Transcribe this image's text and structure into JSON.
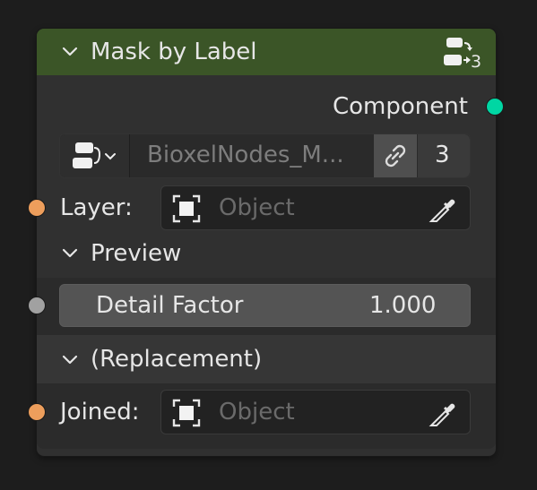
{
  "node": {
    "title": "Mask by Label",
    "header_badge_count": "3",
    "output_socket_label": "Component",
    "datablock": {
      "name": "BioxelNodes_M...",
      "user_count": "3"
    },
    "layer": {
      "label": "Layer:",
      "placeholder": "Object"
    },
    "panels": {
      "preview": {
        "title": "Preview",
        "detail_factor_label": "Detail Factor",
        "detail_factor_value": "1.000"
      },
      "replacement": {
        "title": "(Replacement)",
        "joined_label": "Joined:",
        "joined_placeholder": "Object"
      }
    }
  },
  "colors": {
    "header": "#3b5527",
    "node_body": "#303030",
    "geometry_socket": "#00d6a3",
    "object_socket": "#ed9e5c",
    "float_socket": "#a1a1a1"
  },
  "icons": {
    "collapse": "chevron-down-icon",
    "node_group": "node-group-icon",
    "fake_user": "link-icon",
    "object": "object-icon",
    "eyedropper": "eyedropper-icon"
  }
}
